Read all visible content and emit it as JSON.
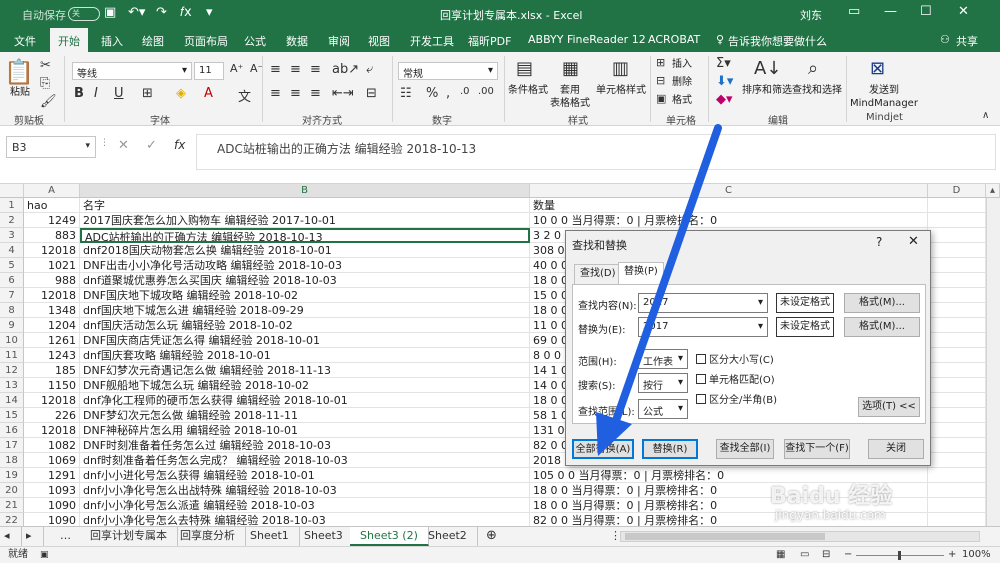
{
  "titlebar": {
    "autosave_label": "自动保存",
    "autosave_state": "关",
    "window_title": "回享计划专属本.xlsx  -  Excel",
    "user": "刘东"
  },
  "ribbon_tabs": [
    "文件",
    "开始",
    "插入",
    "绘图",
    "页面布局",
    "公式",
    "数据",
    "审阅",
    "视图",
    "开发工具",
    "福昕PDF",
    "ABBYY FineReader 12",
    "ACROBAT"
  ],
  "tell_me": "告诉我你想要做什么",
  "share": "共享",
  "ribbon": {
    "paste": "粘贴",
    "clipboard": "剪贴板",
    "font_name": "等线",
    "font_size": "11",
    "font_group": "字体",
    "align_group": "对齐方式",
    "number_format": "常规",
    "number_group": "数字",
    "cond_format": "条件格式",
    "table_format": "套用\n表格格式",
    "cell_style": "单元格样式",
    "style_group": "样式",
    "insert": "插入",
    "delete": "删除",
    "format": "格式",
    "cells_group": "单元格",
    "sort_filter": "排序和筛选",
    "find_select": "查找和选择",
    "edit_group": "编辑",
    "send_mm": "发送到\nMindManager",
    "mindjet_group": "Mindjet"
  },
  "formula": {
    "name_box": "B3",
    "content": "ADC站桩输出的正确方法 编辑经验 2018-10-13"
  },
  "columns": [
    "A",
    "B",
    "C",
    "D"
  ],
  "rows": [
    {
      "n": "1",
      "a": "hao",
      "b": "名字",
      "c": "数量"
    },
    {
      "n": "2",
      "a": "1249",
      "b": "2017国庆套怎么加入购物车 编辑经验 2017-10-01",
      "c": "10 0 0 当月得票：0 | 月票榜排名：0"
    },
    {
      "n": "3",
      "a": "883",
      "b": "ADC站桩输出的正确方法 编辑经验 2018-10-13",
      "c": "3 2 0"
    },
    {
      "n": "4",
      "a": "12018",
      "b": "dnf2018国庆动物套怎么换 编辑经验 2018-10-01",
      "c": "308 0"
    },
    {
      "n": "5",
      "a": "1021",
      "b": "DNF出击小小净化号活动攻略 编辑经验 2018-10-03",
      "c": "40 0 0"
    },
    {
      "n": "6",
      "a": "988",
      "b": "dnf道聚城优惠券怎么买国庆 编辑经验 2018-10-03",
      "c": "18 0 0"
    },
    {
      "n": "7",
      "a": "12018",
      "b": "DNF国庆地下城攻略 编辑经验 2018-10-02",
      "c": "15 0 0"
    },
    {
      "n": "8",
      "a": "1348",
      "b": "dnf国庆地下城怎么进 编辑经验 2018-09-29",
      "c": "18 0 0"
    },
    {
      "n": "9",
      "a": "1204",
      "b": "dnf国庆活动怎么玩 编辑经验 2018-10-02",
      "c": "11 0 0"
    },
    {
      "n": "10",
      "a": "1261",
      "b": "DNF国庆商店凭证怎么得 编辑经验 2018-10-01",
      "c": "69 0 0"
    },
    {
      "n": "11",
      "a": "1243",
      "b": "dnf国庆套攻略 编辑经验 2018-10-01",
      "c": "8 0 0"
    },
    {
      "n": "12",
      "a": "185",
      "b": "DNF幻梦次元奇遇记怎么做 编辑经验 2018-11-13",
      "c": "14 1 0"
    },
    {
      "n": "13",
      "a": "1150",
      "b": "DNF舰船地下城怎么玩 编辑经验 2018-10-02",
      "c": "14 0 0"
    },
    {
      "n": "14",
      "a": "12018",
      "b": "dnf净化工程师的硬币怎么获得 编辑经验 2018-10-01",
      "c": "18 0 0"
    },
    {
      "n": "15",
      "a": "226",
      "b": "DNF梦幻次元怎么做 编辑经验 2018-11-11",
      "c": "58 1 0"
    },
    {
      "n": "16",
      "a": "12018",
      "b": "DNF神秘碎片怎么用 编辑经验 2018-10-01",
      "c": "131 0"
    },
    {
      "n": "17",
      "a": "1082",
      "b": "DNF时刻准备着任务怎么过 编辑经验 2018-10-03",
      "c": "82 0 0"
    },
    {
      "n": "18",
      "a": "1069",
      "b": "dnf时刻准备着任务怎么完成？ 编辑经验 2018-10-03",
      "c": "2018"
    },
    {
      "n": "19",
      "a": "1291",
      "b": "dnf小小进化号怎么获得 编辑经验 2018-10-01",
      "c": "105 0 0 当月得票：0 | 月票榜排名：0"
    },
    {
      "n": "20",
      "a": "1093",
      "b": "dnf小小净化号怎么出战特殊 编辑经验 2018-10-03",
      "c": "18 0 0 当月得票：0 | 月票榜排名：0"
    },
    {
      "n": "21",
      "a": "1090",
      "b": "dnf小小净化号怎么派遣 编辑经验 2018-10-03",
      "c": "18 0 0 当月得票：0 | 月票榜排名：0"
    },
    {
      "n": "22",
      "a": "1090",
      "b": "dnf小小净化号怎么去特殊 编辑经验 2018-10-03",
      "c": "82 0 0 当月得票：0 | 月票榜排名：0"
    }
  ],
  "sheets": [
    "回享计划专属本",
    "回享度分析",
    "Sheet1",
    "Sheet3",
    "Sheet3 (2)",
    "Sheet2"
  ],
  "active_sheet": "Sheet3 (2)",
  "status": {
    "ready": "就绪",
    "zoom": "100%"
  },
  "dialog": {
    "title": "查找和替换",
    "help": "?",
    "tab_find": "查找(D)",
    "tab_replace": "替换(P)",
    "find_label": "查找内容(N):",
    "find_value": "2017",
    "replace_label": "替换为(E):",
    "replace_value": "2017",
    "no_format": "未设定格式",
    "format_btn": "格式(M)...",
    "scope_label": "范围(H):",
    "scope_value": "工作表",
    "search_label": "搜索(S):",
    "search_value": "按行",
    "lookin_label": "查找范围(L):",
    "lookin_value": "公式",
    "match_case": "区分大小写(C)",
    "match_cell": "单元格匹配(O)",
    "match_width": "区分全/半角(B)",
    "options": "选项(T) <<",
    "replace_all": "全部替换(A)",
    "replace": "替换(R)",
    "find_all": "查找全部(I)",
    "find_next": "查找下一个(F)",
    "close": "关闭"
  },
  "watermark": {
    "logo": "Baidu 经验",
    "url": "jingyan.baidu.com"
  },
  "accent": "#217346",
  "arrow_color": "#1f5fe0"
}
